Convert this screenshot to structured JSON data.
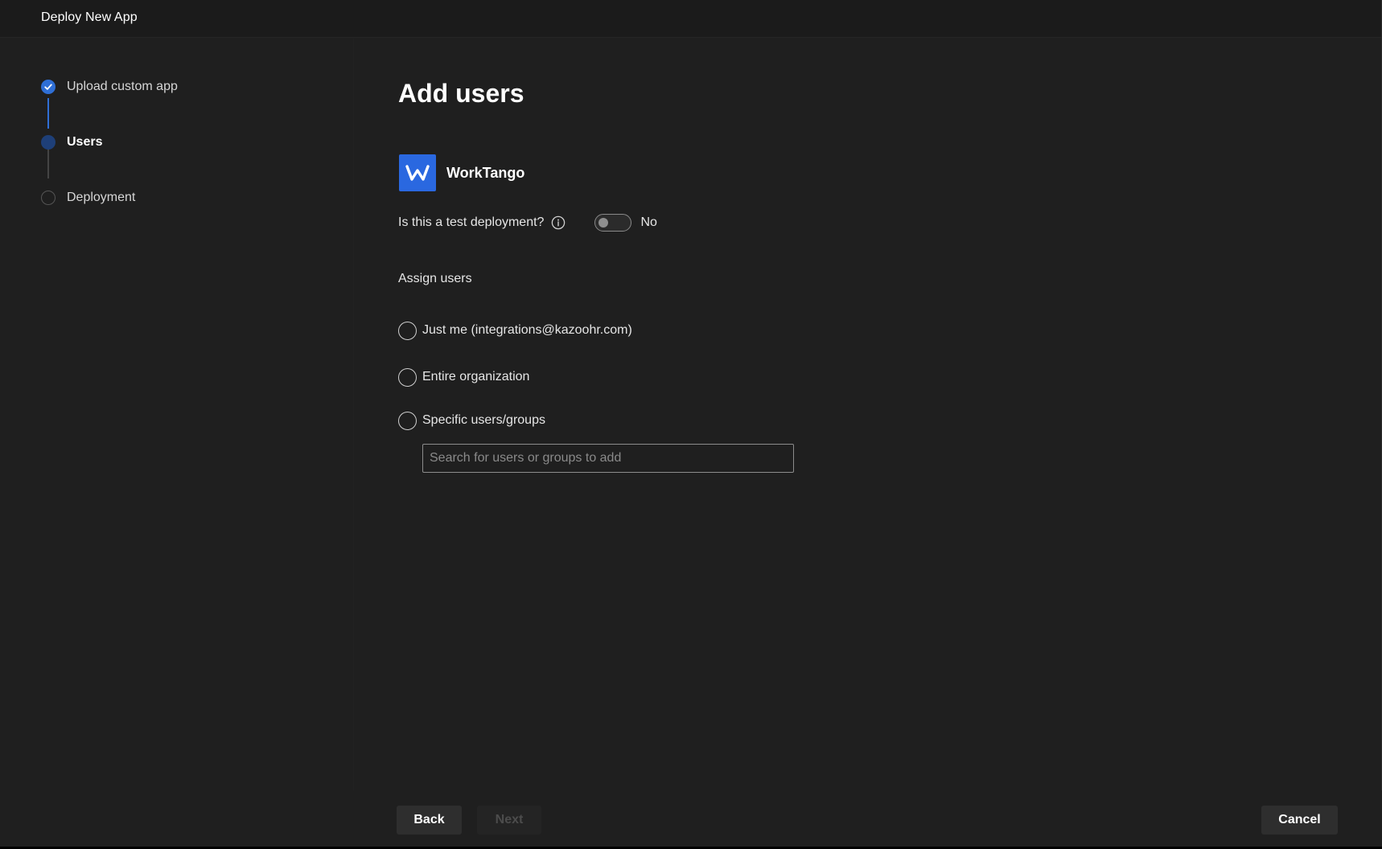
{
  "window": {
    "title": "Deploy New App"
  },
  "steps": [
    {
      "label": "Upload custom app",
      "state": "completed"
    },
    {
      "label": "Users",
      "state": "current"
    },
    {
      "label": "Deployment",
      "state": "pending"
    }
  ],
  "main": {
    "title": "Add users",
    "app": {
      "name": "WorkTango",
      "logo_letter": "W"
    },
    "test_deployment": {
      "label": "Is this a test deployment?",
      "value": "No",
      "enabled": false
    },
    "assign": {
      "label": "Assign users",
      "options": [
        {
          "label": "Just me (integrations@kazoohr.com)",
          "selected": false
        },
        {
          "label": "Entire organization",
          "selected": false
        },
        {
          "label": "Specific users/groups",
          "selected": false
        }
      ],
      "search": {
        "placeholder": "Search for users or groups to add",
        "value": ""
      }
    }
  },
  "footer": {
    "back_label": "Back",
    "next_label": "Next",
    "cancel_label": "Cancel"
  },
  "colors": {
    "accent": "#2f6fd6",
    "background": "#1f1f1f",
    "logo": "#2a68e0"
  }
}
